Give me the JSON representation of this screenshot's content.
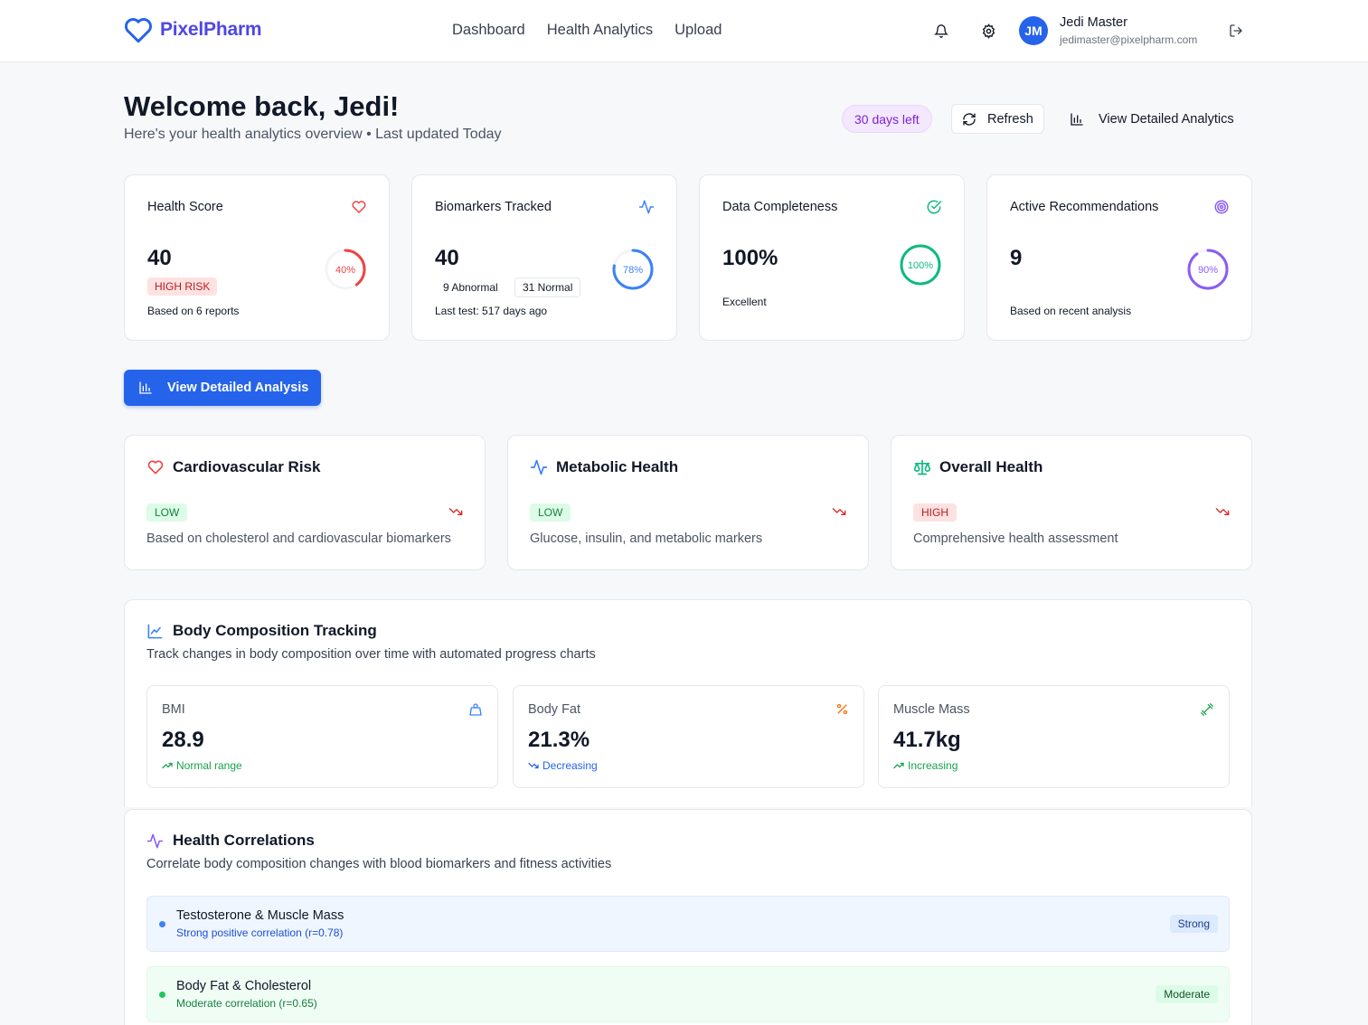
{
  "brand": {
    "name": "PixelPharm",
    "accent": "#4f46e5"
  },
  "nav": {
    "items": [
      "Dashboard",
      "Health Analytics",
      "Upload"
    ]
  },
  "header_icons": {
    "notifications": "bell-icon",
    "settings": "gear-icon",
    "logout": "logout-icon"
  },
  "user": {
    "initials": "JM",
    "name": "Jedi Master",
    "email": "jedimaster@pixelpharm.com"
  },
  "welcome": {
    "title": "Welcome back, Jedi!",
    "subtitle": "Here's your health analytics overview • Last updated Today",
    "days_left": "30 days left",
    "refresh": "Refresh",
    "view_analytics": "View Detailed Analytics"
  },
  "stats": [
    {
      "title": "Health Score",
      "value": "40",
      "badge": "HIGH RISK",
      "footer": "Based on 6 reports",
      "ring_label": "40%",
      "ring_fraction": 0.4,
      "ring_color": "#ef4444",
      "icon": "heart-icon"
    },
    {
      "title": "Biomarkers Tracked",
      "value": "40",
      "abnormal": "9 Abnormal",
      "normal": "31 Normal",
      "footer": "Last test: 517 days ago",
      "ring_label": "78%",
      "ring_fraction": 0.78,
      "ring_color": "#3b82f6",
      "icon": "activity-icon"
    },
    {
      "title": "Data Completeness",
      "value": "100%",
      "footer": "Excellent",
      "ring_label": "100%",
      "ring_fraction": 1.0,
      "ring_color": "#10b981",
      "icon": "check-circle-icon"
    },
    {
      "title": "Active Recommendations",
      "value": "9",
      "footer": "Based on recent analysis",
      "ring_label": "90%",
      "ring_fraction": 0.9,
      "ring_color": "#8b5cf6",
      "icon": "target-icon"
    }
  ],
  "primary_button": "View Detailed Analysis",
  "risks": [
    {
      "title": "Cardiovascular Risk",
      "level": "LOW",
      "desc": "Based on cholesterol and cardiovascular biomarkers",
      "icon": "heart-icon"
    },
    {
      "title": "Metabolic Health",
      "level": "LOW",
      "desc": "Glucose, insulin, and metabolic markers",
      "icon": "activity-icon"
    },
    {
      "title": "Overall Health",
      "level": "HIGH",
      "desc": "Comprehensive health assessment",
      "icon": "scale-icon"
    }
  ],
  "body_composition": {
    "title": "Body Composition Tracking",
    "desc": "Track changes in body composition over time with automated progress charts",
    "metrics": [
      {
        "label": "BMI",
        "value": "28.9",
        "note": "Normal range",
        "icon": "weight-icon"
      },
      {
        "label": "Body Fat",
        "value": "21.3%",
        "note": "Decreasing",
        "icon": "percent-icon"
      },
      {
        "label": "Muscle Mass",
        "value": "41.7kg",
        "note": "Increasing",
        "icon": "dumbbell-icon"
      }
    ]
  },
  "correlations": {
    "title": "Health Correlations",
    "desc": "Correlate body composition changes with blood biomarkers and fitness activities",
    "items": [
      {
        "title": "Testosterone & Muscle Mass",
        "sub": "Strong positive correlation (r=0.78)",
        "badge": "Strong"
      },
      {
        "title": "Body Fat & Cholesterol",
        "sub": "Moderate correlation (r=0.65)",
        "badge": "Moderate"
      }
    ]
  }
}
